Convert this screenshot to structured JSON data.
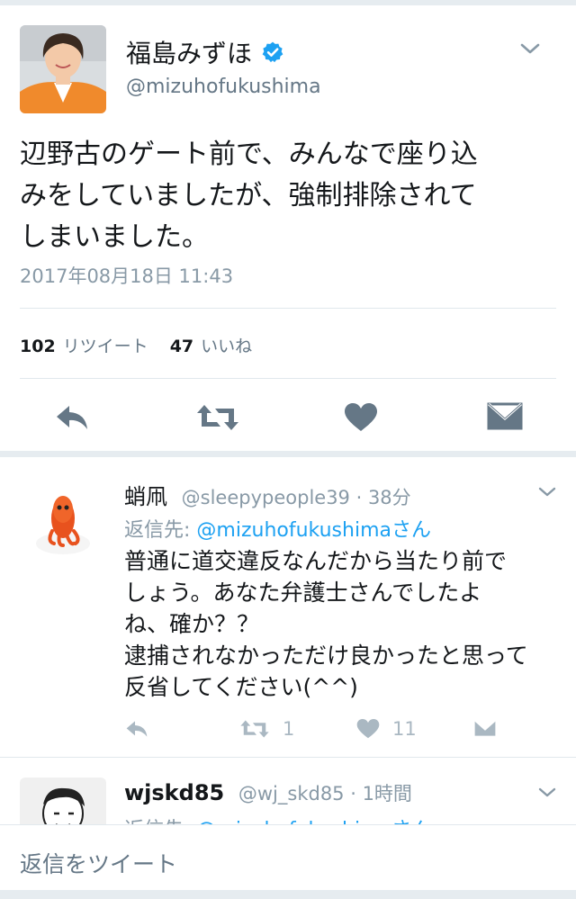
{
  "tweet": {
    "display_name": "福島みずほ",
    "handle": "@mizuhofukushima",
    "text_lines": [
      "辺野古のゲート前で、みんなで座り込",
      "みをしていましたが、強制排除されて",
      "しまいました。"
    ],
    "timestamp": "2017年08月18日 11:43",
    "retweet_count": "102",
    "retweet_label": "リツイート",
    "like_count": "47",
    "like_label": "いいね"
  },
  "replies": [
    {
      "display_name": "蛸凧",
      "handle_meta": "@sleepypeople39 · 38分",
      "reply_to_prefix": "返信先:",
      "reply_to_mention": "@mizuhofukushimaさん",
      "text_lines": [
        "普通に道交違反なんだから当たり前で",
        "しょう。あなた弁護士さんでしたよ",
        "ね、確か？？",
        "逮捕されなかっただけ良かったと思って",
        "反省してください(^^)"
      ],
      "retweet_count": "1",
      "like_count": "11"
    },
    {
      "display_name": "wjskd85",
      "handle_meta": "@wj_skd85 · 1時間",
      "reply_to_prefix": "返信先:",
      "reply_to_mention": "@mizuhofukushimaさん"
    }
  ],
  "compose": {
    "placeholder": "返信をツイート"
  },
  "icons": {
    "verified": "verified-badge-icon",
    "caret": "chevron-down-icon",
    "reply": "reply-icon",
    "retweet": "retweet-icon",
    "like": "heart-icon",
    "dm": "envelope-icon"
  },
  "colors": {
    "link": "#1da1f2",
    "verified": "#1da1f2",
    "icon_main": "#657786",
    "icon_reply": "#aab8c2",
    "muted_text": "#8899a6"
  }
}
